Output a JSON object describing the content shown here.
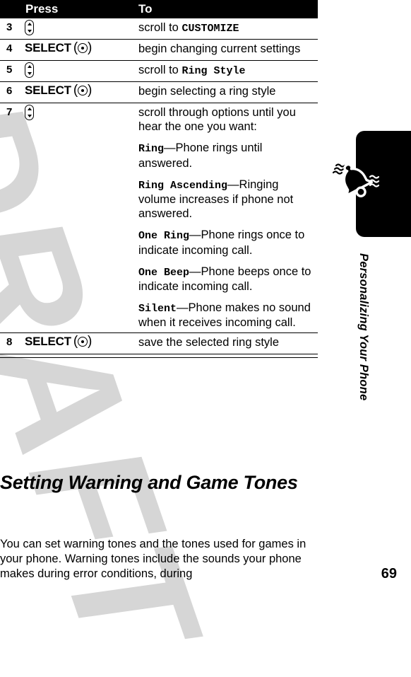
{
  "table": {
    "headers": {
      "press": "Press",
      "to": "To"
    },
    "rows": [
      {
        "num": "3",
        "press_icon": "nav-key-updown",
        "press_label": "",
        "lines": [
          {
            "parts": [
              {
                "t": "scroll to ",
                "style": "normal"
              },
              {
                "t": "CUSTOMIZE",
                "style": "mono"
              }
            ]
          }
        ]
      },
      {
        "num": "4",
        "press_icon": "select-key",
        "press_label": "SELECT",
        "lines": [
          {
            "parts": [
              {
                "t": "begin changing current settings",
                "style": "normal"
              }
            ]
          }
        ]
      },
      {
        "num": "5",
        "press_icon": "nav-key-updown",
        "press_label": "",
        "lines": [
          {
            "parts": [
              {
                "t": "scroll to ",
                "style": "normal"
              },
              {
                "t": "Ring Style",
                "style": "mono"
              }
            ]
          }
        ]
      },
      {
        "num": "6",
        "press_icon": "select-key",
        "press_label": "SELECT",
        "lines": [
          {
            "parts": [
              {
                "t": "begin selecting a ring style",
                "style": "normal"
              }
            ]
          }
        ]
      },
      {
        "num": "7",
        "press_icon": "nav-key-updown",
        "press_label": "",
        "lines": [
          {
            "parts": [
              {
                "t": "scroll through options until you hear the one you want:",
                "style": "normal"
              }
            ]
          },
          {
            "parts": [
              {
                "t": "Ring",
                "style": "mono"
              },
              {
                "t": "—Phone rings until answered.",
                "style": "normal"
              }
            ]
          },
          {
            "parts": [
              {
                "t": "Ring Ascending",
                "style": "mono"
              },
              {
                "t": "—Ringing volume increases if phone not answered.",
                "style": "normal"
              }
            ]
          },
          {
            "parts": [
              {
                "t": "One Ring",
                "style": "mono"
              },
              {
                "t": "—Phone rings once to indicate incoming call.",
                "style": "normal"
              }
            ]
          },
          {
            "parts": [
              {
                "t": "One Beep",
                "style": "mono"
              },
              {
                "t": "—Phone beeps once to indicate incoming call.",
                "style": "normal"
              }
            ]
          },
          {
            "parts": [
              {
                "t": "Silent",
                "style": "mono"
              },
              {
                "t": "—Phone makes no sound when it receives incoming call.",
                "style": "normal"
              }
            ]
          }
        ]
      },
      {
        "num": "8",
        "press_icon": "select-key",
        "press_label": "SELECT",
        "lines": [
          {
            "parts": [
              {
                "t": "save the selected ring style",
                "style": "normal"
              }
            ]
          }
        ]
      }
    ]
  },
  "section": {
    "heading": "Setting Warning and Game Tones",
    "paragraph": "You can set warning tones and the tones used for games in your phone. Warning tones include the sounds your phone makes during error conditions, during"
  },
  "sidebar": {
    "chapter_title": "Personalizing Your Phone",
    "tab_icon": "ringing-bell-icon",
    "tab_color": "#000000"
  },
  "footer": {
    "page_number": "69"
  },
  "watermark": {
    "text": "DRAFT",
    "color": "#d6d6d6"
  }
}
